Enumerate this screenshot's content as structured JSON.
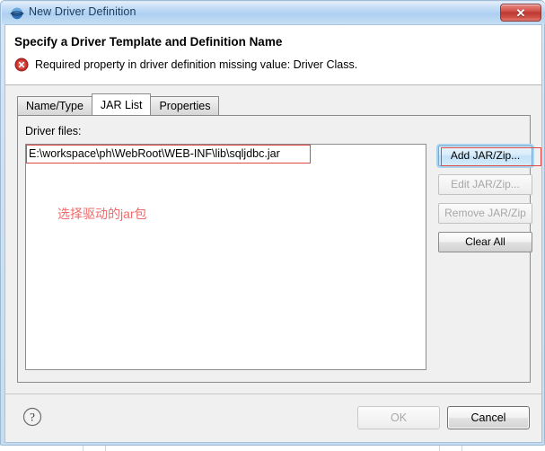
{
  "window": {
    "title": "New Driver Definition",
    "icon": "driver-globe-icon",
    "close_label": "✕"
  },
  "header": {
    "title": "Specify a Driver Template and Definition Name",
    "status_icon": "error-icon",
    "message": "Required property in driver definition missing value: Driver Class."
  },
  "tabs": [
    {
      "label": "Name/Type",
      "selected": false
    },
    {
      "label": "JAR List",
      "selected": true
    },
    {
      "label": "Properties",
      "selected": false
    }
  ],
  "jar_list": {
    "field_label": "Driver files:",
    "files": [
      "E:\\workspace\\ph\\WebRoot\\WEB-INF\\lib\\sqljdbc.jar"
    ],
    "buttons": [
      {
        "label": "Add JAR/Zip...",
        "state": "focused"
      },
      {
        "label": "Edit JAR/Zip...",
        "state": "disabled"
      },
      {
        "label": "Remove JAR/Zip",
        "state": "disabled"
      },
      {
        "label": "Clear All",
        "state": "enabled"
      }
    ]
  },
  "annotations": {
    "color": "#e04848",
    "note_color": "#ef6a6a",
    "note_text": "选择驱动的jar包"
  },
  "footer": {
    "help_label": "?",
    "ok_label": "OK",
    "cancel_label": "Cancel"
  }
}
